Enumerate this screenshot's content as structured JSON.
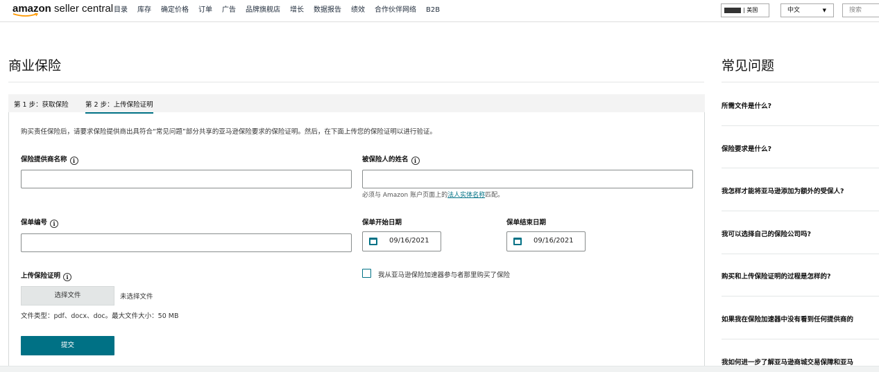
{
  "nav": {
    "logo_bold": "amazon",
    "logo_light": " seller central",
    "links": [
      "目录",
      "库存",
      "确定价格",
      "订单",
      "广告",
      "品牌旗舰店",
      "增长",
      "数据报告",
      "绩效",
      "合作伙伴网络",
      "B2B"
    ],
    "store_label": "| 美国",
    "language": "中文",
    "search_placeholder": "搜索"
  },
  "page": {
    "title": "商业保险",
    "steps": [
      "第 1 步：获取保险",
      "第 2 步：上传保险证明"
    ],
    "intro": "购买责任保险后，请要求保险提供商出具符合“常见问题”部分共享的亚马逊保险要求的保险证明。然后，在下面上传您的保险证明以进行验证。"
  },
  "form": {
    "provider_label": "保险提供商名称",
    "insured_label": "被保险人的姓名",
    "insured_hint_prefix": "必须与 Amazon 账户页面上的",
    "insured_hint_link": "法人实体名称",
    "insured_hint_suffix": "匹配。",
    "policy_label": "保单编号",
    "start_label": "保单开始日期",
    "start_value": "09/16/2021",
    "end_label": "保单结束日期",
    "end_value": "09/16/2021",
    "upload_label": "上传保险证明",
    "accelerator_checkbox": "我从亚马逊保险加速器参与者那里购买了保险",
    "choose_file": "选择文件",
    "no_file": "未选择文件",
    "file_types": "文件类型：pdf、docx、doc。最大文件大小：50 MB",
    "submit": "提交"
  },
  "faq": {
    "title": "常见问题",
    "questions": [
      "所需文件是什么?",
      "保险要求是什么?",
      "我怎样才能将亚马逊添加为额外的受保人?",
      "我可以选择自己的保险公司吗?",
      "购买和上传保险证明的过程是怎样的?",
      "如果我在保险加速器中没有看到任何提供商的",
      "我如何进一步了解亚马逊商城交易保障和亚马"
    ]
  },
  "colors": {
    "accent": "#007185",
    "logo_smile": "#ff9900"
  }
}
